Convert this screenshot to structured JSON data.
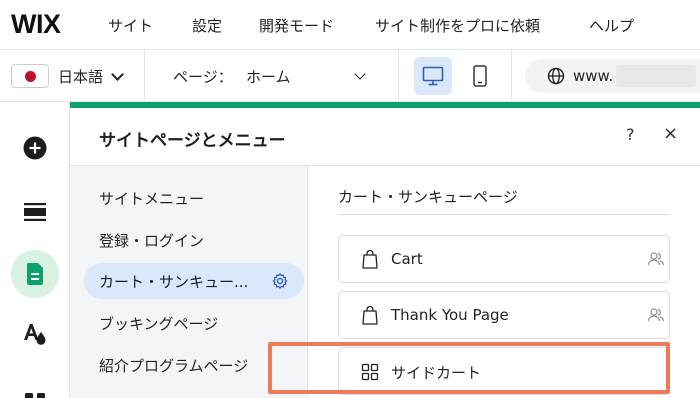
{
  "topbar": {
    "logo": "WIX",
    "menu": [
      "サイト",
      "設定",
      "開発モード",
      "サイト制作をプロに依頼",
      "ヘルプ"
    ]
  },
  "toolbar": {
    "language": "日本語",
    "page_label": "ページ：",
    "page_value": "ホーム",
    "url_prefix": "www."
  },
  "panel": {
    "title": "サイトページとメニュー",
    "help": "?",
    "close": "×",
    "nav": [
      "サイトメニュー",
      "登録・ログイン",
      "カート・サンキュー...",
      "ブッキングページ",
      "紹介プログラムページ"
    ],
    "selected_nav": "カート・サンキュー...",
    "section_title": "カート・サンキューページ",
    "pages": [
      {
        "label": "Cart",
        "icon": "shopping-bag-icon"
      },
      {
        "label": "Thank You Page",
        "icon": "shopping-bag-icon"
      },
      {
        "label": "サイドカート",
        "icon": "grid-icon"
      }
    ]
  },
  "colors": {
    "accent_blue": "#dbe8fb",
    "green_strip": "#0e9f6e",
    "highlight_border": "#ee7a5c",
    "active_rail": "#d7f1e2"
  }
}
